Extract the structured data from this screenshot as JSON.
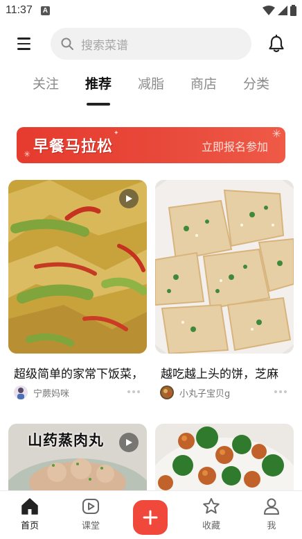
{
  "status_bar": {
    "time": "11:37",
    "notification": "A"
  },
  "header": {
    "search_placeholder": "搜索菜谱"
  },
  "tabs": [
    {
      "label": "关注",
      "active": false
    },
    {
      "label": "推荐",
      "active": true
    },
    {
      "label": "减脂",
      "active": false
    },
    {
      "label": "商店",
      "active": false
    },
    {
      "label": "分类",
      "active": false
    }
  ],
  "banner": {
    "title": "早餐马拉松",
    "cta": "立即报名参加"
  },
  "feed": [
    {
      "title": "超级简单的家常下饭菜，",
      "author": "宁蕨妈咪",
      "has_video": true,
      "image": "stir-fried tofu skin with green and red peppers"
    },
    {
      "title": "越吃越上头的饼，芝麻",
      "author": "小丸子宝贝g",
      "has_video": false,
      "image": "sesame scallion pancake squares"
    },
    {
      "title": "",
      "author": "",
      "has_video": true,
      "image": "steamed yam meatballs",
      "overlay_text": "山药蒸肉丸"
    },
    {
      "title": "",
      "author": "",
      "has_video": false,
      "image": "chicken with broccoli"
    }
  ],
  "bottom_nav": {
    "items": [
      {
        "label": "首页",
        "icon": "home-icon",
        "active": true
      },
      {
        "label": "课堂",
        "icon": "video-play-icon",
        "active": false
      },
      {
        "label": "收藏",
        "icon": "star-icon",
        "active": false
      },
      {
        "label": "我",
        "icon": "user-icon",
        "active": false
      }
    ],
    "add_icon": "plus-icon"
  },
  "colors": {
    "accent": "#f0483a",
    "banner": "#e63b2e",
    "search_bg": "#f1f1f1"
  }
}
